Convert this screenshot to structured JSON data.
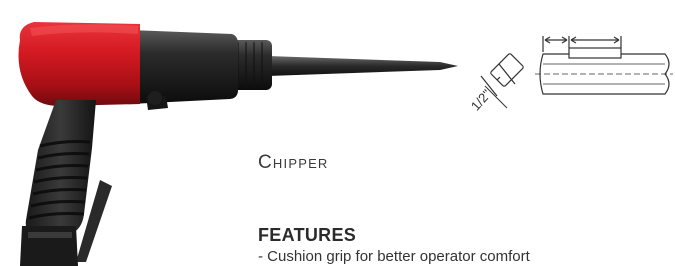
{
  "product": {
    "name": "Chipper"
  },
  "diagram": {
    "shank_size_label": "1/2\""
  },
  "features": {
    "heading": "FEATURES",
    "items": [
      "- Cushion grip for better operator comfort"
    ]
  }
}
